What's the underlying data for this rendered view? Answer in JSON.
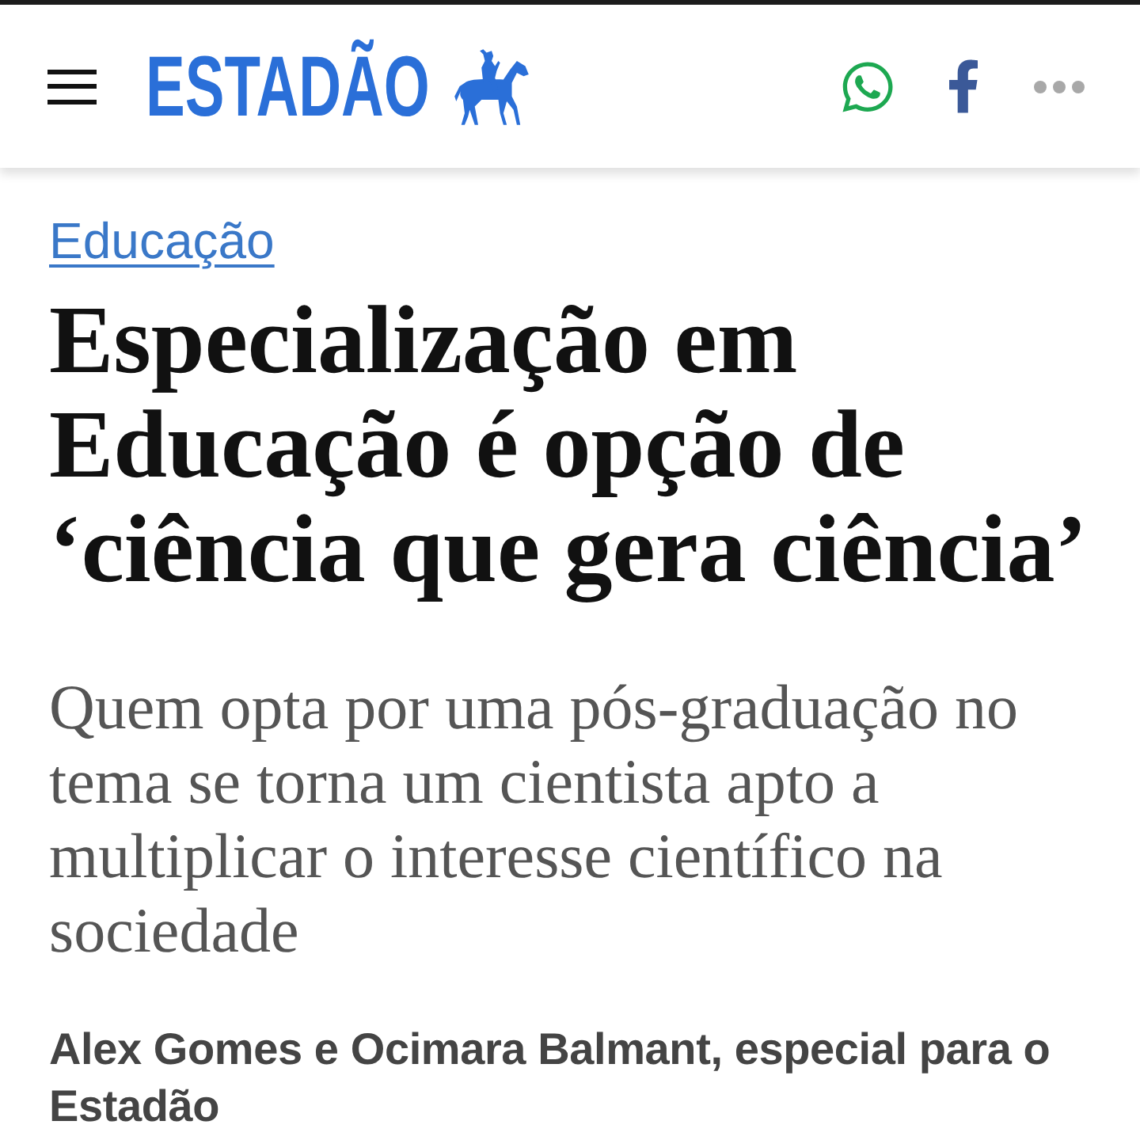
{
  "header": {
    "logo_text": "ESTADÃO"
  },
  "article": {
    "section": "Educação",
    "headline": "Especialização em Educação é opção de ‘ciência que gera ciência’",
    "subtitle": "Quem opta por uma pós-graduação no tema se torna um cientista apto a multiplicar o interesse científico na sociedade",
    "byline": "Alex Gomes e Ocimara Balmant, especial para o Estadão"
  }
}
